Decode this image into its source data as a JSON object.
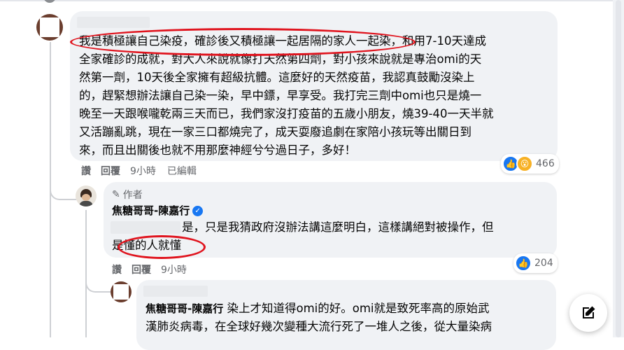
{
  "comment1": {
    "text_lines": [
      "我是積極讓自己染疫，確診後又積極讓一起居隔的家人一起染，和用7-10天達成",
      "全家確診的成就，對大人來說就像打天然第四劑，對小孩來說就是專治omi的天",
      "然第一劑，10天後全家擁有超級抗體。這麼好的天然疫苗，我認真鼓勵沒染上",
      "的，趕緊想辦法讓自己染一染，早中鏢，早享受。我打完三劑中omi也只是燒一",
      "晚至一天跟喉嚨乾兩三天而已，我們家沒打疫苗的五歲小朋友，燒39-40一天半就",
      "又活蹦亂跳，現在一家三口都燒完了，成天耍廢追劇在家陪小孩玩等出關日到",
      "來，而且出關後也就不用那麼神經兮兮過日子，多好！"
    ],
    "actions": {
      "like": "讚",
      "reply": "回覆",
      "time": "9小時",
      "edited": "已編輯"
    },
    "reaction_count": "466"
  },
  "reply1": {
    "author_badge": "作者",
    "author_name": "焦糖哥哥-陳嘉行",
    "text_line1": "是，只是我猜政府沒辦法講這麼明白，這樣講絕對被操作，但",
    "text_line2": "是懂的人就懂",
    "actions": {
      "like": "讚",
      "reply": "回覆",
      "time": "9小時"
    },
    "reaction_count": "204"
  },
  "reply2": {
    "author_name": "焦糖哥哥-陳嘉行",
    "text_line1_rest": " 染上才知道得omi的好。omi就是致死率高的原始武",
    "text_line2": "漢肺炎病毒，在全球好幾次變種大流行死了一堆人之後，從大量染病"
  },
  "icons": {
    "badge_icon": "pen-icon",
    "compose_icon": "compose-icon",
    "verified_icon": "verified-check-icon"
  },
  "colors": {
    "accent": "#1877f2",
    "annotation_red": "#e0141e"
  }
}
